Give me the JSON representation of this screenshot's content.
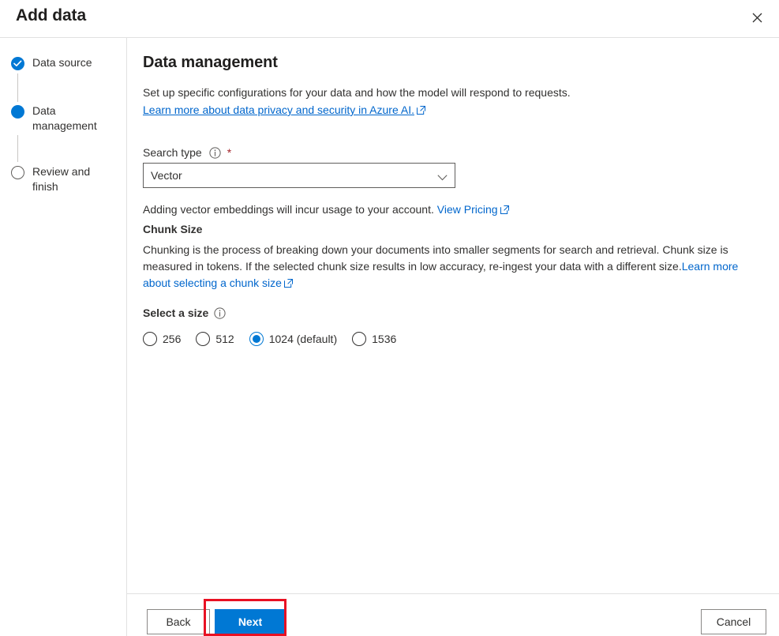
{
  "dialog": {
    "title": "Add data",
    "close_icon": "close-icon"
  },
  "sidebar": {
    "steps": [
      {
        "label": "Data source",
        "state": "completed",
        "marker_icon": "check-icon"
      },
      {
        "label": "Data management",
        "state": "current",
        "marker_icon": "filled-circle-icon"
      },
      {
        "label": "Review and finish",
        "state": "todo",
        "marker_icon": "empty-circle-icon"
      }
    ]
  },
  "content": {
    "title": "Data management",
    "intro": "Set up specific configurations for your data and how the model will respond to requests.",
    "privacy_link": "Learn more about data privacy and security in Azure AI.",
    "search_type": {
      "label": "Search type",
      "info_icon": "info-icon",
      "required_marker": "*",
      "value": "Vector",
      "chevron_icon": "chevron-down-icon",
      "options": [
        "Vector"
      ]
    },
    "pricing_note_prefix": "Adding vector embeddings will incur usage to your account. ",
    "pricing_link": "View Pricing",
    "chunk_size_heading": "Chunk Size",
    "chunk_description_prefix": "Chunking is the process of breaking down your documents into smaller segments for search and retrieval. Chunk size is measured in tokens. If the selected chunk size results in low accuracy, re-ingest your data with a different size.",
    "chunk_link": "Learn more about selecting a chunk size",
    "select_size_label": "Select a size",
    "select_size_info_icon": "info-icon",
    "sizes": [
      {
        "label": "256",
        "selected": false
      },
      {
        "label": "512",
        "selected": false
      },
      {
        "label": "1024 (default)",
        "selected": true
      },
      {
        "label": "1536",
        "selected": false
      }
    ]
  },
  "footer": {
    "back_label": "Back",
    "next_label": "Next",
    "cancel_label": "Cancel"
  },
  "annotation": {
    "target": "next-button",
    "color": "#e81123"
  },
  "colors": {
    "accent": "#0078d4",
    "link": "#0066cc",
    "required": "#a4262c",
    "annotation": "#e81123",
    "border": "#e1e1e1",
    "text": "#323130"
  }
}
